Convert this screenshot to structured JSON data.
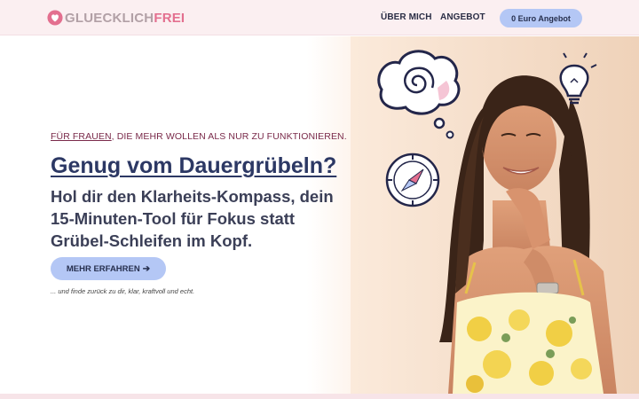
{
  "header": {
    "logo_part1": "GLUECKLICH",
    "logo_part2": "FREI",
    "nav": [
      {
        "label": "ÜBER MICH"
      },
      {
        "label": "ANGEBOT"
      }
    ],
    "cta_label": "0 Euro Angebot"
  },
  "hero": {
    "eyebrow_underlined": "FÜR FRAUEN",
    "eyebrow_rest": ", DIE MEHR WOLLEN ALS NUR ZU FUNKTIONIEREN.",
    "headline": "Genug vom Dauergrübeln?",
    "subhead": "Hol dir den Klarheits-Kompass, dein 15-Minuten-Tool für Fokus statt Grübel-Schleifen im Kopf.",
    "cta_label": "MEHR ERFAHREN",
    "cta_arrow": "➔",
    "note": "... und finde zurück zu dir, klar, kraftvoll und echt."
  },
  "photo": {
    "icons": [
      "thought-bubble-icon",
      "lightbulb-icon",
      "compass-icon"
    ]
  },
  "colors": {
    "header_bg": "#fbeff1",
    "accent_button": "#b4c7f5",
    "headline": "#2c3864",
    "logo_pink": "#e36f8f"
  }
}
